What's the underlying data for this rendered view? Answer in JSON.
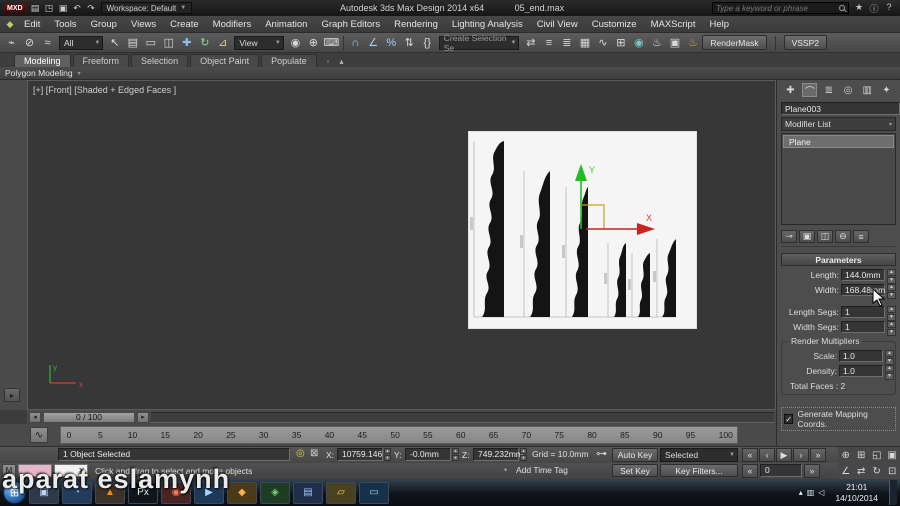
{
  "titlebar": {
    "logo": "MXD",
    "quick_icons": [
      {
        "name": "new-scene-icon",
        "glyph": "▤"
      },
      {
        "name": "open-file-icon",
        "glyph": "◳"
      },
      {
        "name": "save-file-icon",
        "glyph": "▣"
      },
      {
        "name": "undo-icon",
        "glyph": "↶"
      },
      {
        "name": "redo-icon",
        "glyph": "↷"
      }
    ],
    "workspace_label": "Workspace: Default",
    "app_title": "Autodesk 3ds Max Design 2014 x64",
    "file_name": "05_end.max",
    "search_placeholder": "Type a keyword or phrase",
    "right_icons": [
      {
        "name": "favorites-icon",
        "glyph": "★"
      },
      {
        "name": "info-center-icon",
        "glyph": "ⓘ"
      },
      {
        "name": "help-icon",
        "glyph": "?"
      }
    ]
  },
  "menubar": {
    "logo_glyph": "◆",
    "items": [
      "Edit",
      "Tools",
      "Group",
      "Views",
      "Create",
      "Modifiers",
      "Animation",
      "Graph Editors",
      "Rendering",
      "Lighting Analysis",
      "Civil View",
      "Customize",
      "MAXScript",
      "Help"
    ]
  },
  "toolbar": {
    "group1": [
      {
        "name": "select-link-icon",
        "glyph": "⌁"
      },
      {
        "name": "unlink-icon",
        "glyph": "⊘"
      },
      {
        "name": "bind-spacewarp-icon",
        "glyph": "≈"
      }
    ],
    "filter_value": "All",
    "group2": [
      {
        "name": "select-object-icon",
        "glyph": "↖"
      },
      {
        "name": "select-by-name-icon",
        "glyph": "▤"
      },
      {
        "name": "rect-region-icon",
        "glyph": "▭"
      },
      {
        "name": "window-crossing-icon",
        "glyph": "◫"
      }
    ],
    "group3": [
      {
        "name": "select-move-icon",
        "glyph": "✚",
        "color": "#8fc1ee"
      },
      {
        "name": "select-rotate-icon",
        "glyph": "↻",
        "color": "#93d693"
      },
      {
        "name": "select-scale-icon",
        "glyph": "⊿",
        "color": "#dfd08a"
      }
    ],
    "coord_value": "View",
    "group4": [
      {
        "name": "pivot-center-icon",
        "glyph": "◉"
      },
      {
        "name": "select-manipulate-icon",
        "glyph": "⊕"
      },
      {
        "name": "keyboard-override-icon",
        "glyph": "⌨"
      }
    ],
    "group5": [
      {
        "name": "snap-toggle-icon",
        "glyph": "∩",
        "color": "#9fd2f2"
      },
      {
        "name": "angle-snap-icon",
        "glyph": "∠",
        "color": "#9fd2f2"
      },
      {
        "name": "percent-snap-icon",
        "glyph": "%",
        "color": "#9fd2f2"
      },
      {
        "name": "spinner-snap-icon",
        "glyph": "⇅"
      },
      {
        "name": "named-selection-sets-icon",
        "glyph": "{}"
      }
    ],
    "selection_set_value": "Create Selection Se",
    "group7": [
      {
        "name": "mirror-icon",
        "glyph": "⇄"
      },
      {
        "name": "align-icon",
        "glyph": "≡"
      },
      {
        "name": "layer-manager-icon",
        "glyph": "≣"
      },
      {
        "name": "graphite-toggle-icon",
        "glyph": "▦"
      },
      {
        "name": "curve-editor-icon",
        "glyph": "∿"
      },
      {
        "name": "schematic-view-icon",
        "glyph": "⊞"
      },
      {
        "name": "material-editor-icon",
        "glyph": "◉",
        "color": "#79c8c8"
      },
      {
        "name": "render-setup-icon",
        "glyph": "♨"
      },
      {
        "name": "rendered-frame-icon",
        "glyph": "▣"
      },
      {
        "name": "render-production-icon",
        "glyph": "♨",
        "color": "#e8a23c"
      }
    ],
    "rendermask_label": "RenderMask",
    "vssp_label": "VSSP2"
  },
  "ribbon": {
    "tabs": [
      {
        "label": "Modeling",
        "active": true
      },
      {
        "label": "Freeform"
      },
      {
        "label": "Selection"
      },
      {
        "label": "Object Paint"
      },
      {
        "label": "Populate"
      }
    ],
    "config_glyph": "◦",
    "minimize_glyph": "▴",
    "panel_label": "Polygon Modeling",
    "panel_caret": "▾"
  },
  "viewport": {
    "label": "[+] [Front] [Shaded + Edged Faces ]",
    "axis_x": "X",
    "axis_y": "Y",
    "tripod_x": "x",
    "tripod_y": "y",
    "layout_arrow_glyph": "▸"
  },
  "command_panel": {
    "tabs": [
      {
        "name": "create-tab",
        "glyph": "✚"
      },
      {
        "name": "modify-tab",
        "glyph": "⌒",
        "active": true
      },
      {
        "name": "hierarchy-tab",
        "glyph": "≣"
      },
      {
        "name": "motion-tab",
        "glyph": "◎"
      },
      {
        "name": "display-tab",
        "glyph": "▥"
      },
      {
        "name": "utilities-tab",
        "glyph": "✦"
      }
    ],
    "object_name": "Plane003",
    "modifier_list_label": "Modifier List",
    "dropdown_caret": "▾",
    "stack_items": [
      {
        "label": "Plane",
        "active": true
      }
    ],
    "stack_buttons": [
      {
        "name": "pin-stack-icon",
        "glyph": "⊸"
      },
      {
        "name": "show-end-result-icon",
        "glyph": "▣"
      },
      {
        "name": "make-unique-icon",
        "glyph": "◫"
      },
      {
        "name": "remove-modifier-icon",
        "glyph": "⊖"
      },
      {
        "name": "configure-modifier-sets-icon",
        "glyph": "≡"
      }
    ],
    "rollout_title": "Parameters",
    "params": [
      {
        "label": "Length:",
        "value": "144.0mm"
      },
      {
        "label": "Width:",
        "value": "168.48mm"
      }
    ],
    "seg_params": [
      {
        "label": "Length Segs:",
        "value": "1"
      },
      {
        "label": "Width Segs:",
        "value": "1"
      }
    ],
    "render_multipliers": {
      "title": "Render Multipliers",
      "params": [
        {
          "label": "Scale:",
          "value": "1.0"
        },
        {
          "label": "Density:",
          "value": "1.0"
        }
      ],
      "total_faces": "Total Faces : 2"
    },
    "generate_mapping": "Generate Mapping Coords.",
    "check_glyph": "✓"
  },
  "timeline": {
    "left_arrow": "◂",
    "right_arrow": "▸",
    "slider_label": "0 / 100",
    "curve_editor_glyph": "∿",
    "ticks": [
      "0",
      "5",
      "10",
      "15",
      "20",
      "25",
      "30",
      "35",
      "40",
      "45",
      "50",
      "55",
      "60",
      "65",
      "70",
      "75",
      "80",
      "85",
      "90",
      "95",
      "100"
    ]
  },
  "statusbar": {
    "selection_status": "1 Object Selected",
    "isolate_glyph": "◎",
    "lock_glyph": "⊠",
    "x_label": "X:",
    "x_value": "10759.146",
    "y_label": "Y:",
    "y_value": "-0.0mm",
    "z_label": "Z:",
    "z_value": "749.232mm",
    "grid_label": "Grid = 10.0mm",
    "setkeys_glyph": "⊶",
    "auto_key_label": "Auto Key",
    "selected_value": "Selected",
    "set_key_label": "Set Key",
    "key_filters_label": "Key Filters...",
    "mxs_label": "M",
    "listener_close_glyph": "✕",
    "prompt": "Click and drag to select and move objects",
    "timetag_glyph": "◔",
    "add_time_tag": "Add Time Tag",
    "current_frame": "0",
    "playback": [
      {
        "name": "go-to-start-icon",
        "glyph": "«"
      },
      {
        "name": "previous-frame-icon",
        "glyph": "‹"
      },
      {
        "name": "play-icon",
        "glyph": "▶"
      },
      {
        "name": "next-frame-icon",
        "glyph": "›"
      },
      {
        "name": "go-to-end-icon",
        "glyph": "»"
      }
    ],
    "key_step_back_glyph": "«",
    "key_step_fwd_glyph": "»",
    "nav_row1": [
      {
        "name": "zoom-icon",
        "glyph": "⊕"
      },
      {
        "name": "zoom-all-icon",
        "glyph": "⊞"
      },
      {
        "name": "zoom-extents-icon",
        "glyph": "◱"
      },
      {
        "name": "zoom-extents-all-icon",
        "glyph": "▣"
      }
    ],
    "nav_row2": [
      {
        "name": "fov-icon",
        "glyph": "∠"
      },
      {
        "name": "pan-icon",
        "glyph": "⇄"
      },
      {
        "name": "orbit-icon",
        "glyph": "↻"
      },
      {
        "name": "maximize-viewport-icon",
        "glyph": "⊡"
      }
    ]
  },
  "taskbar": {
    "start_glyph": "⊞",
    "apps": [
      {
        "name": "app-window-icon",
        "glyph": "▣",
        "bg": "#2e3a4a",
        "color": "#bcd6f0"
      },
      {
        "name": "browser-icon",
        "glyph": "◔",
        "bg": "#243c5c",
        "color": "#8fc4f4"
      },
      {
        "name": "vlc-icon",
        "glyph": "▲",
        "bg": "#3b332a",
        "color": "#ff8a00"
      },
      {
        "name": "px-app-icon",
        "glyph": "Px",
        "bg": "#10151c",
        "color": "#f0f0f0"
      },
      {
        "name": "red-app-icon",
        "glyph": "◉",
        "bg": "#4a2420",
        "color": "#ff7a5c"
      },
      {
        "name": "media-player-icon",
        "glyph": "▶",
        "bg": "#1c3a57",
        "color": "#a8d4ff"
      },
      {
        "name": "orange-app-icon",
        "glyph": "◆",
        "bg": "#4a3a1a",
        "color": "#ffb347"
      },
      {
        "name": "green-app-icon",
        "glyph": "◈",
        "bg": "#1f3d24",
        "color": "#7fd48a"
      },
      {
        "name": "impress-app-icon",
        "glyph": "▤",
        "bg": "#1f2f4a",
        "color": "#9fc2ff"
      },
      {
        "name": "folder-icon",
        "glyph": "▱",
        "bg": "#4a4120",
        "color": "#ffd24a"
      },
      {
        "name": "display-app-icon",
        "glyph": "▭",
        "bg": "#16324a",
        "color": "#9fd0ff"
      }
    ],
    "tray_icons": [
      {
        "name": "tray-expand-icon",
        "glyph": "▴"
      },
      {
        "name": "network-icon",
        "glyph": "▥"
      },
      {
        "name": "volume-icon",
        "glyph": "◁"
      }
    ],
    "time": "21:01",
    "date": "14/10/2014"
  },
  "watermark": "aparat eslamynh"
}
